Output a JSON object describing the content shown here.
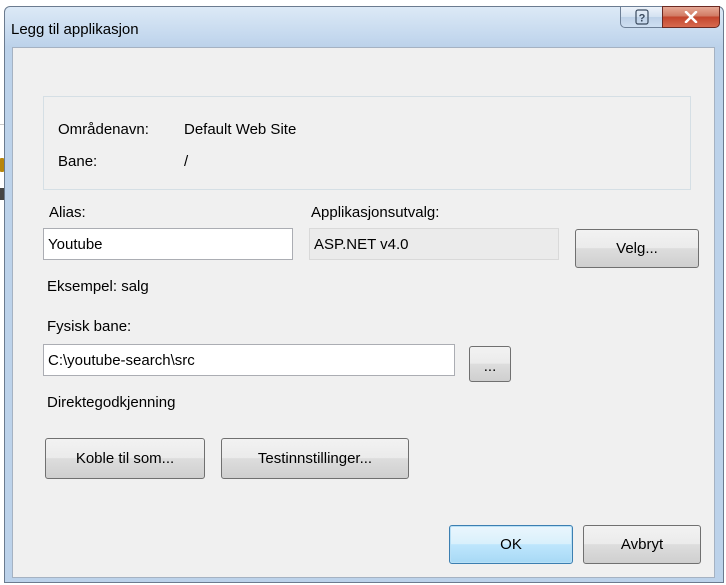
{
  "window": {
    "title": "Legg til applikasjon",
    "help_icon": "question-icon",
    "close_icon": "close-x-icon"
  },
  "site_info": {
    "site_label": "Områdenavn:",
    "site_value": "Default Web Site",
    "path_label": "Bane:",
    "path_value": "/"
  },
  "alias": {
    "label": "Alias:",
    "value": "Youtube",
    "example": "Eksempel: salg"
  },
  "app_pool": {
    "label": "Applikasjonsutvalg:",
    "value": "ASP.NET v4.0",
    "select_button": "Velg..."
  },
  "physical_path": {
    "label": "Fysisk bane:",
    "value": "C:\\youtube-search\\src",
    "browse_button": "..."
  },
  "auth": {
    "label": "Direktegodkjenning",
    "connect_as_button": "Koble til som...",
    "test_settings_button": "Testinnstillinger..."
  },
  "footer": {
    "ok_button": "OK",
    "cancel_button": "Avbryt"
  },
  "colors": {
    "close_button": "#c2452d",
    "titlebar": "#bcd2ea",
    "client_bg": "#f0f0f0",
    "default_button_border": "#3c7fb1"
  }
}
